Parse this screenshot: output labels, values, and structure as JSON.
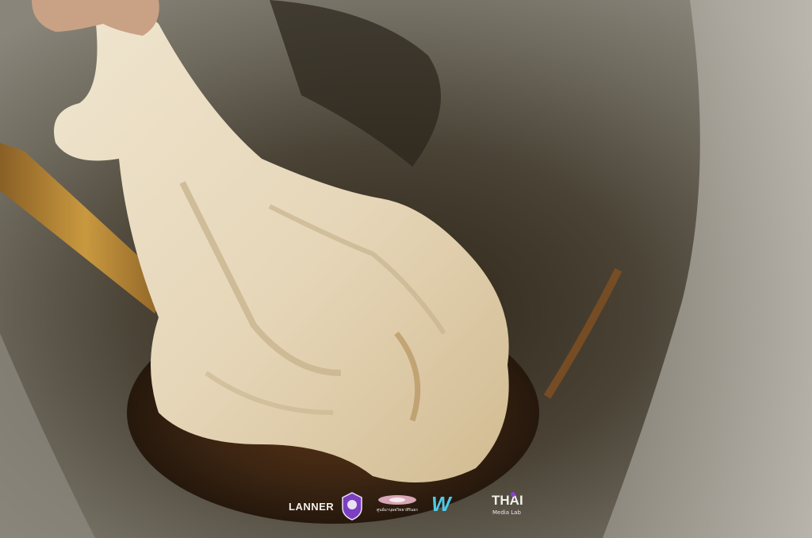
{
  "photo": {
    "subject": "dough-kneading-in-brown-syrup",
    "colors": {
      "dough": "#e9dcc2",
      "dough_shadow": "#c8b48f",
      "syrup": "#3a2412",
      "bowl": "#6f6a5e",
      "spoon": "#b98a3e"
    }
  },
  "logos": {
    "lanner": "LANNER",
    "center_text": "ศูนย์มานุษยวิทยาสิรินธร",
    "w_mark": "W",
    "thai_line1": "THAI",
    "thai_line2": "Media Lab"
  }
}
